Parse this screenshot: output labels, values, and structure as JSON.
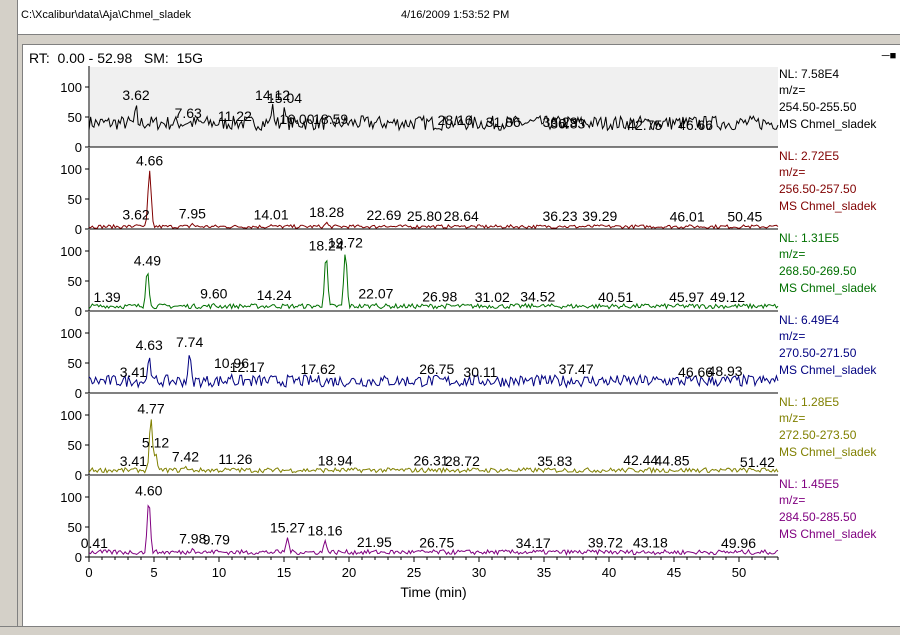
{
  "header": {
    "path": "C:\\Xcalibur\\data\\Aja\\Chmel_sladek",
    "datetime": "4/16/2009 1:53:52 PM"
  },
  "panel": {
    "rt_range": "RT:  0.00 - 52.98",
    "smoothing": "SM:  15G",
    "pin_icon": "pin-icon"
  },
  "chart_data": {
    "type": "line",
    "xlabel": "Time (min)",
    "xlim": [
      0,
      53
    ],
    "x_ticks": [
      0,
      5,
      10,
      15,
      20,
      25,
      30,
      35,
      40,
      45,
      50
    ],
    "ylim": [
      0,
      100
    ],
    "y_ticks": [
      0,
      50,
      100
    ],
    "traces": [
      {
        "color": "#000000",
        "nl": "NL: 7.58E4",
        "mz_label": "m/z=",
        "mz": "254.50-255.50",
        "ms": "MS Chmel_sladek",
        "highlighted": true,
        "baseline": 40,
        "noise": 12,
        "peaks": [
          [
            3.62,
            60
          ],
          [
            5.0,
            30
          ],
          [
            7.63,
            30
          ],
          [
            11.22,
            25
          ],
          [
            14.12,
            60
          ],
          [
            15.04,
            55
          ],
          [
            16.0,
            20
          ],
          [
            18.59,
            20
          ],
          [
            28.16,
            18
          ],
          [
            31.86,
            15
          ],
          [
            36.23,
            15
          ],
          [
            36.83,
            12
          ],
          [
            42.75,
            10
          ],
          [
            46.66,
            10
          ]
        ],
        "labels": [
          [
            3.62,
            "3.62"
          ],
          [
            7.63,
            "7.63"
          ],
          [
            11.22,
            "11.22"
          ],
          [
            14.12,
            "14.12"
          ],
          [
            15.04,
            "15.04"
          ],
          [
            16.0,
            "16.00"
          ],
          [
            18.59,
            "18.59"
          ],
          [
            28.16,
            "28.16"
          ],
          [
            31.86,
            "31.86"
          ],
          [
            36.23,
            "36.23"
          ],
          [
            36.83,
            "36.83"
          ],
          [
            42.75,
            "42.75"
          ],
          [
            46.66,
            "46.66"
          ]
        ]
      },
      {
        "color": "#800000",
        "nl": "NL: 2.72E5",
        "mz_label": "m/z=",
        "mz": "256.50-257.50",
        "ms": "MS Chmel_sladek",
        "highlighted": false,
        "baseline": 4,
        "noise": 3,
        "peaks": [
          [
            3.62,
            6
          ],
          [
            4.66,
            96
          ],
          [
            7.95,
            8
          ],
          [
            14.01,
            6
          ],
          [
            18.28,
            10
          ],
          [
            22.69,
            5
          ],
          [
            25.8,
            4
          ],
          [
            28.64,
            4
          ],
          [
            36.23,
            4
          ],
          [
            39.29,
            4
          ],
          [
            46.01,
            3
          ],
          [
            50.45,
            3
          ]
        ],
        "labels": [
          [
            3.62,
            "3.62"
          ],
          [
            4.66,
            "4.66"
          ],
          [
            7.95,
            "7.95"
          ],
          [
            14.01,
            "14.01"
          ],
          [
            18.28,
            "18.28"
          ],
          [
            22.69,
            "22.69"
          ],
          [
            25.8,
            "25.80"
          ],
          [
            28.64,
            "28.64"
          ],
          [
            36.23,
            "36.23"
          ],
          [
            39.29,
            "39.29"
          ],
          [
            46.01,
            "46.01"
          ],
          [
            50.45,
            "50.45"
          ]
        ]
      },
      {
        "color": "#007000",
        "nl": "NL: 1.31E5",
        "mz_label": "m/z=",
        "mz": "268.50-269.50",
        "ms": "MS Chmel_sladek",
        "highlighted": false,
        "baseline": 8,
        "noise": 4,
        "peaks": [
          [
            1.39,
            4
          ],
          [
            4.49,
            65
          ],
          [
            9.6,
            10
          ],
          [
            14.24,
            8
          ],
          [
            18.24,
            90
          ],
          [
            19.72,
            95
          ],
          [
            22.07,
            10
          ],
          [
            26.98,
            5
          ],
          [
            31.02,
            4
          ],
          [
            34.52,
            5
          ],
          [
            40.51,
            4
          ],
          [
            45.97,
            4
          ],
          [
            49.12,
            4
          ]
        ],
        "labels": [
          [
            1.39,
            "1.39"
          ],
          [
            4.49,
            "4.49"
          ],
          [
            9.6,
            "9.60"
          ],
          [
            14.24,
            "14.24"
          ],
          [
            18.24,
            "18.24"
          ],
          [
            19.72,
            "19.72"
          ],
          [
            22.07,
            "22.07"
          ],
          [
            26.98,
            "26.98"
          ],
          [
            31.02,
            "31.02"
          ],
          [
            34.52,
            "34.52"
          ],
          [
            40.51,
            "40.51"
          ],
          [
            45.97,
            "45.97"
          ],
          [
            49.12,
            "49.12"
          ]
        ]
      },
      {
        "color": "#000080",
        "nl": "NL: 6.49E4",
        "mz_label": "m/z=",
        "mz": "270.50-271.50",
        "ms": "MS Chmel_sladek",
        "highlighted": false,
        "baseline": 20,
        "noise": 10,
        "peaks": [
          [
            3.41,
            10
          ],
          [
            4.63,
            55
          ],
          [
            7.74,
            60
          ],
          [
            10.96,
            25
          ],
          [
            12.17,
            18
          ],
          [
            17.62,
            15
          ],
          [
            26.75,
            15
          ],
          [
            30.11,
            10
          ],
          [
            37.47,
            15
          ],
          [
            46.66,
            10
          ],
          [
            48.93,
            12
          ]
        ],
        "labels": [
          [
            3.41,
            "3.41"
          ],
          [
            4.63,
            "4.63"
          ],
          [
            7.74,
            "7.74"
          ],
          [
            10.96,
            "10.96"
          ],
          [
            12.17,
            "12.17"
          ],
          [
            17.62,
            "17.62"
          ],
          [
            26.75,
            "26.75"
          ],
          [
            30.11,
            "30.11"
          ],
          [
            37.47,
            "37.47"
          ],
          [
            46.66,
            "46.66"
          ],
          [
            48.93,
            "48.93"
          ]
        ]
      },
      {
        "color": "#808000",
        "nl": "NL: 1.28E5",
        "mz_label": "m/z=",
        "mz": "272.50-273.50",
        "ms": "MS Chmel_sladek",
        "highlighted": false,
        "baseline": 8,
        "noise": 4,
        "peaks": [
          [
            3.41,
            4
          ],
          [
            4.77,
            92
          ],
          [
            5.12,
            35
          ],
          [
            7.42,
            12
          ],
          [
            11.26,
            8
          ],
          [
            18.94,
            5
          ],
          [
            26.31,
            5
          ],
          [
            28.72,
            4
          ],
          [
            35.83,
            4
          ],
          [
            42.44,
            6
          ],
          [
            44.85,
            5
          ],
          [
            51.42,
            3
          ]
        ],
        "labels": [
          [
            3.41,
            "3.41"
          ],
          [
            4.77,
            "4.77"
          ],
          [
            5.12,
            "5.12"
          ],
          [
            7.42,
            "7.42"
          ],
          [
            11.26,
            "11.26"
          ],
          [
            18.94,
            "18.94"
          ],
          [
            26.31,
            "26.31"
          ],
          [
            28.72,
            "28.72"
          ],
          [
            35.83,
            "35.83"
          ],
          [
            42.44,
            "42.44"
          ],
          [
            44.85,
            "44.85"
          ],
          [
            51.42,
            "51.42"
          ]
        ]
      },
      {
        "color": "#800080",
        "nl": "NL: 1.45E5",
        "mz_label": "m/z=",
        "mz": "284.50-285.50",
        "ms": "MS Chmel_sladek",
        "highlighted": false,
        "baseline": 8,
        "noise": 4,
        "peaks": [
          [
            0.41,
            4
          ],
          [
            4.6,
            92
          ],
          [
            7.98,
            12
          ],
          [
            9.79,
            10
          ],
          [
            15.27,
            30
          ],
          [
            18.16,
            25
          ],
          [
            21.95,
            6
          ],
          [
            26.75,
            5
          ],
          [
            34.17,
            4
          ],
          [
            39.72,
            5
          ],
          [
            43.18,
            5
          ],
          [
            49.96,
            4
          ]
        ],
        "labels": [
          [
            0.41,
            "0.41"
          ],
          [
            4.6,
            "4.60"
          ],
          [
            7.98,
            "7.98"
          ],
          [
            9.79,
            "9.79"
          ],
          [
            15.27,
            "15.27"
          ],
          [
            18.16,
            "18.16"
          ],
          [
            21.95,
            "21.95"
          ],
          [
            26.75,
            "26.75"
          ],
          [
            34.17,
            "34.17"
          ],
          [
            39.72,
            "39.72"
          ],
          [
            43.18,
            "43.18"
          ],
          [
            49.96,
            "49.96"
          ]
        ]
      }
    ]
  }
}
